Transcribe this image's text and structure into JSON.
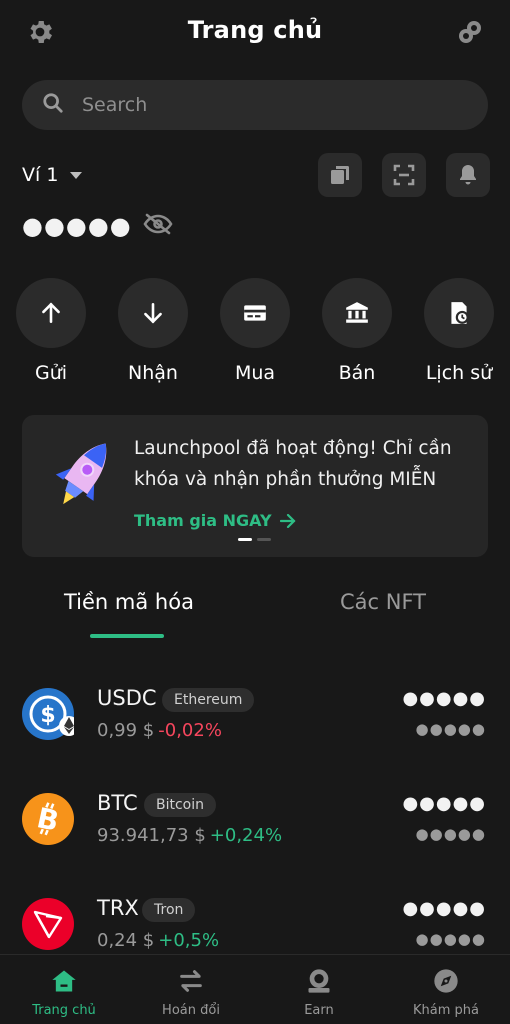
{
  "header": {
    "title": "Trang chủ",
    "settings_icon": "gear-icon",
    "connect_icon": "link-icon"
  },
  "search": {
    "placeholder": "Search"
  },
  "wallet": {
    "name": "Ví 1"
  },
  "toolbar_icons": [
    "copy-icon",
    "scan-icon",
    "bell-icon"
  ],
  "balance": {
    "masked": "●●●●●"
  },
  "actions": [
    {
      "label": "Gửi",
      "icon": "arrow-up-icon"
    },
    {
      "label": "Nhận",
      "icon": "arrow-down-icon"
    },
    {
      "label": "Mua",
      "icon": "card-icon"
    },
    {
      "label": "Bán",
      "icon": "bank-icon"
    },
    {
      "label": "Lịch sử",
      "icon": "history-icon"
    }
  ],
  "banner": {
    "text": "Launchpool đã hoạt động! Chỉ cần khóa và nhận phần thưởng MIỄN",
    "cta": "Tham gia NGAY"
  },
  "tabs": [
    {
      "label": "Tiền mã hóa",
      "active": true
    },
    {
      "label": "Các NFT",
      "active": false
    }
  ],
  "assets": [
    {
      "symbol": "USDC",
      "chain": "Ethereum",
      "price": "0,99 $",
      "change": "-0,02%",
      "change_color": "#f6465d",
      "value": "●●●●●",
      "value_fiat": "●●●●●"
    },
    {
      "symbol": "BTC",
      "chain": "Bitcoin",
      "price": "93.941,73 $",
      "change": "+0,24%",
      "change_color": "#2ebd85",
      "value": "●●●●●",
      "value_fiat": "●●●●●"
    },
    {
      "symbol": "TRX",
      "chain": "Tron",
      "price": "0,24 $",
      "change": "+0,5%",
      "change_color": "#2ebd85",
      "value": "●●●●●",
      "value_fiat": "●●●●●"
    }
  ],
  "nav": [
    {
      "label": "Trang chủ",
      "active": true
    },
    {
      "label": "Hoán đổi",
      "active": false
    },
    {
      "label": "Earn",
      "active": false
    },
    {
      "label": "Khám phá",
      "active": false
    }
  ],
  "colors": {
    "accent": "#2ebd85",
    "negative": "#f6465d",
    "background": "#181818",
    "surface": "#2b2b2b"
  }
}
